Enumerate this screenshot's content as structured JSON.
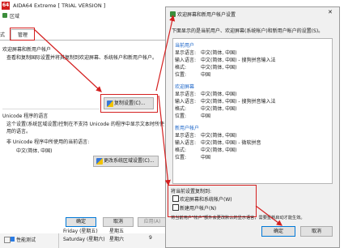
{
  "aida": {
    "title": "AIDA64 Extreme  [ TRIAL VERSION ]",
    "logo": "64",
    "tree_items": [
      {
        "label": "性能测试"
      }
    ],
    "table_rows": [
      {
        "col1": "Friday (星期五)",
        "col2": "星期五"
      },
      {
        "col1": "Saturday (星期六)",
        "col2": "星期六"
      }
    ],
    "counter": "9"
  },
  "region": {
    "window_title": "区域",
    "tabs": [
      "式",
      "管理"
    ],
    "section1_title": "欢迎屏幕和新用户帐户",
    "section1_desc": "查看和复制国际设置并将其复制到欢迎屏幕、系统帐户和新用户帐户。",
    "copy_button": "复制设置(C)...",
    "section2_title": "Unicode 程序的语言",
    "section2_desc": "这个设置(系统区域设置)控制在不支持 Unicode 的程序中显示文本时所使用的语言。",
    "current_label": "非 Unicode 程序中所使用的当前语言:",
    "current_value": "中文(简体, 中国)",
    "change_button": "更改系统区域设置(C)...",
    "ok_button": "确定",
    "cancel_button": "取消",
    "apply_button": "应用(A)"
  },
  "welcome": {
    "window_title": "欢迎屏幕和新用户帐户设置",
    "close_glyph": "✕",
    "intro": "下面显示的是当前用户、欢迎屏幕(系统帐户)和新用户帐户的设置(S)。",
    "groups": [
      {
        "heading": "当前用户",
        "rows": [
          {
            "name": "显示语言:",
            "value": "中文(简体, 中国)"
          },
          {
            "name": "输入语言:",
            "value": "中文(简体, 中国) - 搜狗拼音输入法"
          },
          {
            "name": "格式:",
            "value": "中文(简体, 中国)"
          },
          {
            "name": "位置:",
            "value": "中国"
          }
        ]
      },
      {
        "heading": "欢迎屏幕",
        "rows": [
          {
            "name": "显示语言:",
            "value": "中文(简体, 中国)"
          },
          {
            "name": "输入语言:",
            "value": "中文(简体, 中国) - 搜狗拼音输入法"
          },
          {
            "name": "格式:",
            "value": "中文(简体, 中国)"
          },
          {
            "name": "位置:",
            "value": "中国"
          }
        ]
      },
      {
        "heading": "新用户帐户",
        "rows": [
          {
            "name": "显示语言:",
            "value": "中文(简体, 中国)"
          },
          {
            "name": "输入语言:",
            "value": "中文(简体, 中国) - 微软拼音"
          },
          {
            "name": "格式:",
            "value": "中文(简体, 中国)"
          },
          {
            "name": "位置:",
            "value": "中国"
          }
        ]
      }
    ],
    "copy_section_title": "将当前设置复制到:",
    "checkbox_welcome": "欢迎屏幕和系统帐户(W)",
    "checkbox_newuser": "新建用户帐户(N)",
    "note": "将当前用户\"帐户\"额外会更改默认的显示语言，需要重新启动才能生效。",
    "ok_button": "确定",
    "cancel_button": "取消"
  }
}
